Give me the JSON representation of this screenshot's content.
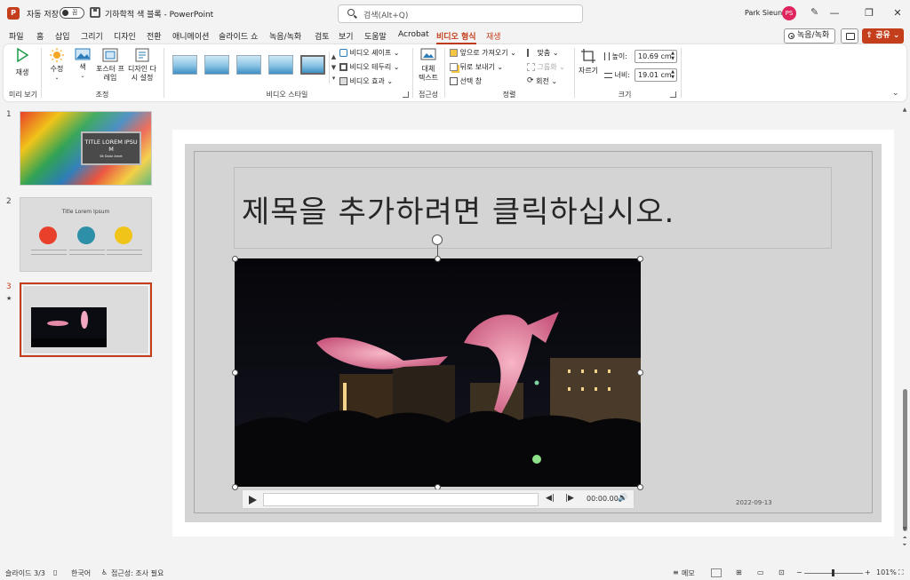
{
  "titlebar": {
    "app_logo": "P",
    "autosave_label": "자동 저장",
    "autosave_state": "끔",
    "document_title": "기하학적 색 블록 - PowerPoint",
    "search_placeholder": "검색(Alt+Q)",
    "user_name": "Park Sieun",
    "user_initials": "PS",
    "minimize": "—",
    "restore": "❐",
    "close": "✕"
  },
  "menu": {
    "tabs": [
      "파일",
      "홈",
      "삽입",
      "그리기",
      "디자인",
      "전환",
      "애니메이션",
      "슬라이드 쇼",
      "녹음/녹화",
      "검토",
      "보기",
      "도움말",
      "Acrobat",
      "비디오 형식",
      "재생"
    ],
    "active_tab": "비디오 형식",
    "record_label": "녹음/녹화",
    "share_label": "공유"
  },
  "ribbon": {
    "preview": {
      "play_label": "재생",
      "group": "미리 보기"
    },
    "adjust": {
      "group": "조정",
      "corrections": "수정",
      "color": "색",
      "poster_frame_l1": "포스터 프",
      "poster_frame_l2": "레임",
      "reset_design_l1": "디자인 다",
      "reset_design_l2": "시 설정"
    },
    "video_styles": {
      "group": "비디오 스타일",
      "shape": "비디오 셰이프",
      "border": "비디오 테두리",
      "effects": "비디오 효과"
    },
    "accessibility": {
      "group": "접근성",
      "alt_text_l1": "대체",
      "alt_text_l2": "텍스트"
    },
    "arrange": {
      "group": "정렬",
      "bring_forward": "앞으로 가져오기",
      "send_backward": "뒤로 보내기",
      "selection_pane": "선택 창",
      "align": "맞춤",
      "group_btn": "그룹화",
      "rotate": "회전"
    },
    "size": {
      "group": "크기",
      "crop": "자르기",
      "height_label": "높이:",
      "height_value": "10.69 cm",
      "width_label": "너비:",
      "width_value": "19.01 cm"
    }
  },
  "slides_panel": {
    "slides": [
      {
        "number": "1",
        "title": "TITLE LOREM IPSU M",
        "subtitle": "Sit Dolor Amet"
      },
      {
        "number": "2",
        "title": "Title Lorem Ipsum"
      },
      {
        "number": "3"
      }
    ]
  },
  "slide": {
    "title_placeholder": "제목을 추가하려면 클릭하십시오.",
    "date": "2022-09-13",
    "video_time": "00:00.00"
  },
  "statusbar": {
    "slide_indicator": "슬라이드 3/3",
    "language": "한국어",
    "accessibility": "접근성: 조사 필요",
    "notes": "메모",
    "zoom": "101%"
  },
  "colors": {
    "accent": "#c43e1c",
    "ribbon_bg": "#ffffff",
    "window_bg": "#f3f3f3"
  }
}
